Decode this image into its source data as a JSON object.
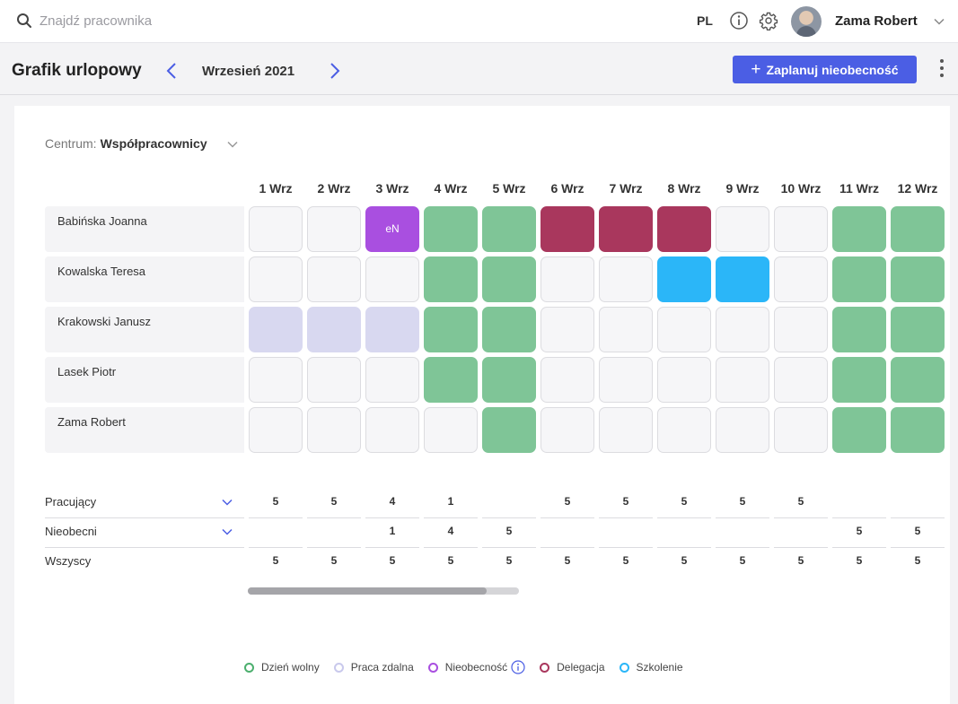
{
  "topbar": {
    "search_placeholder": "Znajdź pracownika",
    "language": "PL",
    "user_name": "Zama Robert"
  },
  "subbar": {
    "title": "Grafik urlopowy",
    "month": "Wrzesień 2021",
    "plan_button": "Zaplanuj nieobecność"
  },
  "centrum": {
    "label": "Centrum:",
    "value": "Współpracownicy"
  },
  "days": [
    "1 Wrz",
    "2 Wrz",
    "3 Wrz",
    "4 Wrz",
    "5 Wrz",
    "6 Wrz",
    "7 Wrz",
    "8 Wrz",
    "9 Wrz",
    "10 Wrz",
    "11 Wrz",
    "12 Wrz"
  ],
  "employees": [
    {
      "name": "Babińska Joanna",
      "cells": [
        "empty",
        "empty",
        "absence",
        "off",
        "off",
        "deleg",
        "deleg",
        "deleg",
        "empty",
        "empty",
        "off",
        "off"
      ],
      "cell_texts": [
        "",
        "",
        "eN",
        "",
        "",
        "",
        "",
        "",
        "",
        "",
        "",
        ""
      ]
    },
    {
      "name": "Kowalska Teresa",
      "cells": [
        "empty",
        "empty",
        "empty",
        "off",
        "off",
        "empty",
        "empty",
        "train",
        "train",
        "empty",
        "off",
        "off"
      ],
      "cell_texts": [
        "",
        "",
        "",
        "",
        "",
        "",
        "",
        "",
        "",
        "",
        "",
        ""
      ]
    },
    {
      "name": "Krakowski Janusz",
      "cells": [
        "remote",
        "remote",
        "remote",
        "off",
        "off",
        "empty",
        "empty",
        "empty",
        "empty",
        "empty",
        "off",
        "off"
      ],
      "cell_texts": [
        "",
        "",
        "",
        "",
        "",
        "",
        "",
        "",
        "",
        "",
        "",
        ""
      ]
    },
    {
      "name": "Lasek Piotr",
      "cells": [
        "empty",
        "empty",
        "empty",
        "off",
        "off",
        "empty",
        "empty",
        "empty",
        "empty",
        "empty",
        "off",
        "off"
      ],
      "cell_texts": [
        "",
        "",
        "",
        "",
        "",
        "",
        "",
        "",
        "",
        "",
        "",
        ""
      ]
    },
    {
      "name": "Zama Robert",
      "cells": [
        "empty",
        "empty",
        "empty",
        "empty",
        "off",
        "empty",
        "empty",
        "empty",
        "empty",
        "empty",
        "off",
        "off"
      ],
      "cell_texts": [
        "",
        "",
        "",
        "",
        "",
        "",
        "",
        "",
        "",
        "",
        "",
        ""
      ]
    }
  ],
  "summary": [
    {
      "label": "Pracujący",
      "expandable": true,
      "values": [
        "5",
        "5",
        "4",
        "1",
        "",
        "5",
        "5",
        "5",
        "5",
        "5",
        "",
        ""
      ]
    },
    {
      "label": "Nieobecni",
      "expandable": true,
      "values": [
        "",
        "",
        "1",
        "4",
        "5",
        "",
        "",
        "",
        "",
        "",
        "5",
        "5"
      ]
    },
    {
      "label": "Wszyscy",
      "expandable": false,
      "values": [
        "5",
        "5",
        "5",
        "5",
        "5",
        "5",
        "5",
        "5",
        "5",
        "5",
        "5",
        "5"
      ]
    }
  ],
  "scrollbar": {
    "position_fraction": 0.88
  },
  "legend": [
    {
      "label": "Dzień wolny",
      "color": "#4caf6e",
      "info": false
    },
    {
      "label": "Praca zdalna",
      "color": "#c9c9ec",
      "info": false
    },
    {
      "label": "Nieobecność",
      "color": "#a94fe0",
      "info": true
    },
    {
      "label": "Delegacja",
      "color": "#a9375d",
      "info": false
    },
    {
      "label": "Szkolenie",
      "color": "#2bb6f8",
      "info": false
    }
  ],
  "colors": {
    "accent": "#4b5ee4",
    "day_off": "#7fc597",
    "remote": "#d8d8f0",
    "absence": "#a94fe0",
    "delegation": "#a9375d",
    "training": "#2bb6f8"
  }
}
